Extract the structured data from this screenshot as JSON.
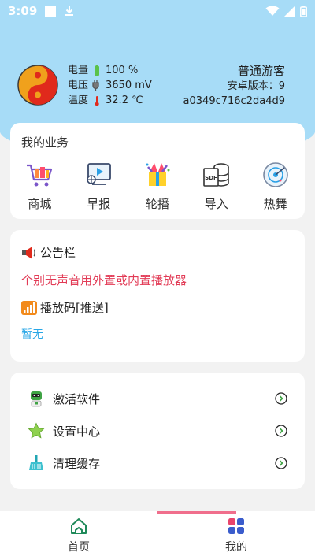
{
  "status_bar": {
    "time": "3:09"
  },
  "device": {
    "battery_label": "电量",
    "battery_value": "100 %",
    "voltage_label": "电压",
    "voltage_value": "3650 mV",
    "temp_label": "温度",
    "temp_value": "32.2 ℃"
  },
  "user": {
    "name": "普通游客",
    "android_version": "安卓版本：9",
    "device_id": "a0349c716c2da4d9"
  },
  "services": {
    "title": "我的业务",
    "items": [
      {
        "label": "商城",
        "icon": "shopping-cart-icon"
      },
      {
        "label": "早报",
        "icon": "monitor-play-icon"
      },
      {
        "label": "轮播",
        "icon": "gift-box-icon"
      },
      {
        "label": "导入",
        "icon": "sdf-database-icon"
      },
      {
        "label": "热舞",
        "icon": "radar-disc-icon"
      }
    ]
  },
  "notice": {
    "title": "公告栏",
    "message": "个别无声音用外置或内置播放器",
    "code_title": "播放码[推送]",
    "code_value": "暂无"
  },
  "menu": {
    "items": [
      {
        "label": "激活软件",
        "icon": "robot-icon"
      },
      {
        "label": "设置中心",
        "icon": "star-icon"
      },
      {
        "label": "清理缓存",
        "icon": "broom-icon"
      }
    ]
  },
  "bottom_nav": {
    "items": [
      {
        "label": "首页",
        "icon": "home-icon"
      },
      {
        "label": "我的",
        "icon": "grid-icon"
      }
    ],
    "active_index": 1
  },
  "colors": {
    "header_bg": "#a7dcf7",
    "alert_text": "#e23b56",
    "code_text": "#27a6e6",
    "active_indicator": "#f06e8c"
  }
}
